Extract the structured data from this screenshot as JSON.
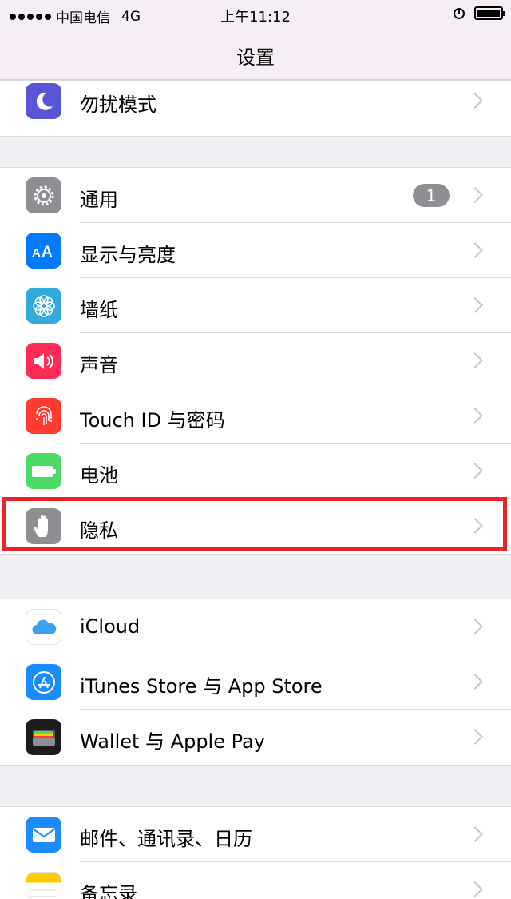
{
  "status_bar": {
    "carrier": "中国电信",
    "network": "4G",
    "time": "上午11:12"
  },
  "nav": {
    "title": "设置"
  },
  "groups": [
    {
      "items": [
        {
          "label": "勿扰模式",
          "icon": "moon-icon",
          "color": "#5856d6"
        }
      ]
    },
    {
      "items": [
        {
          "label": "通用",
          "icon": "gear-icon",
          "color": "#8e8e93",
          "badge": "1"
        },
        {
          "label": "显示与亮度",
          "icon": "display-aa-icon",
          "color": "#007aff"
        },
        {
          "label": "墙纸",
          "icon": "wallpaper-flower-icon",
          "color": "#34aadc"
        },
        {
          "label": "声音",
          "icon": "speaker-icon",
          "color": "#ff2d55"
        },
        {
          "label": "Touch ID 与密码",
          "icon": "fingerprint-icon",
          "color": "#ff3b30"
        },
        {
          "label": "电池",
          "icon": "battery-icon",
          "color": "#4cd964"
        },
        {
          "label": "隐私",
          "icon": "hand-icon",
          "color": "#8e8e93",
          "highlighted": true
        }
      ]
    },
    {
      "items": [
        {
          "label": "iCloud",
          "icon": "icloud-icon",
          "color": "#ffffff"
        },
        {
          "label": "iTunes Store 与 App Store",
          "icon": "app-store-icon",
          "color": "#1a8cff"
        },
        {
          "label": "Wallet 与 Apple Pay",
          "icon": "wallet-icon",
          "color": "#1c1c1e"
        }
      ]
    },
    {
      "items": [
        {
          "label": "邮件、通讯录、日历",
          "icon": "mail-icon",
          "color": "#1a8cff"
        },
        {
          "label": "备忘录",
          "icon": "notes-icon",
          "color": "#ffcc00"
        }
      ]
    }
  ],
  "colors": {
    "highlight_border": "#e8242a",
    "background": "#efeff4",
    "nav_background": "#f7eef5"
  }
}
